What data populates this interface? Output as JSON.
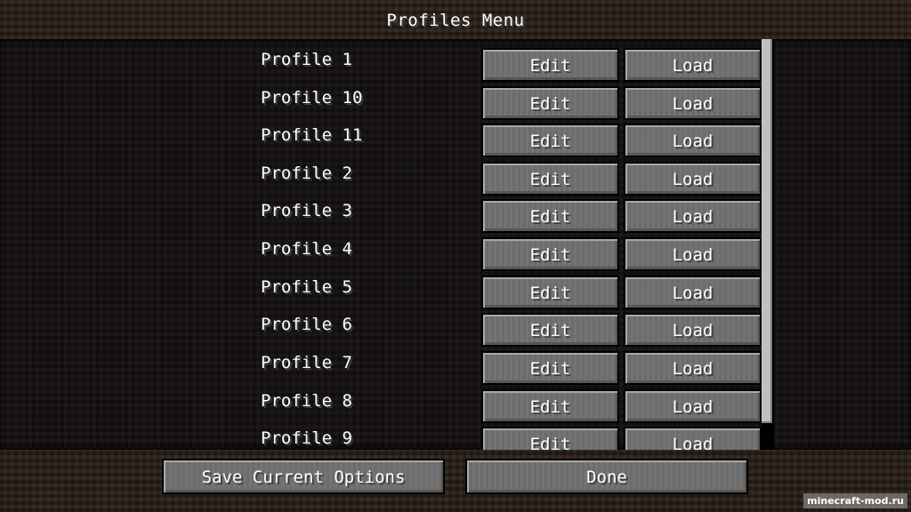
{
  "header": {
    "title": "Profiles Menu"
  },
  "profiles": [
    {
      "name": "Profile 1",
      "edit_label": "Edit",
      "load_label": "Load"
    },
    {
      "name": "Profile 10",
      "edit_label": "Edit",
      "load_label": "Load"
    },
    {
      "name": "Profile 11",
      "edit_label": "Edit",
      "load_label": "Load"
    },
    {
      "name": "Profile 2",
      "edit_label": "Edit",
      "load_label": "Load"
    },
    {
      "name": "Profile 3",
      "edit_label": "Edit",
      "load_label": "Load"
    },
    {
      "name": "Profile 4",
      "edit_label": "Edit",
      "load_label": "Load"
    },
    {
      "name": "Profile 5",
      "edit_label": "Edit",
      "load_label": "Load"
    },
    {
      "name": "Profile 6",
      "edit_label": "Edit",
      "load_label": "Load"
    },
    {
      "name": "Profile 7",
      "edit_label": "Edit",
      "load_label": "Load"
    },
    {
      "name": "Profile 8",
      "edit_label": "Edit",
      "load_label": "Load"
    },
    {
      "name": "Profile 9",
      "edit_label": "Edit",
      "load_label": "Load"
    }
  ],
  "footer": {
    "save_label": "Save Current Options",
    "done_label": "Done"
  },
  "watermark": "minecraft-mod.ru"
}
